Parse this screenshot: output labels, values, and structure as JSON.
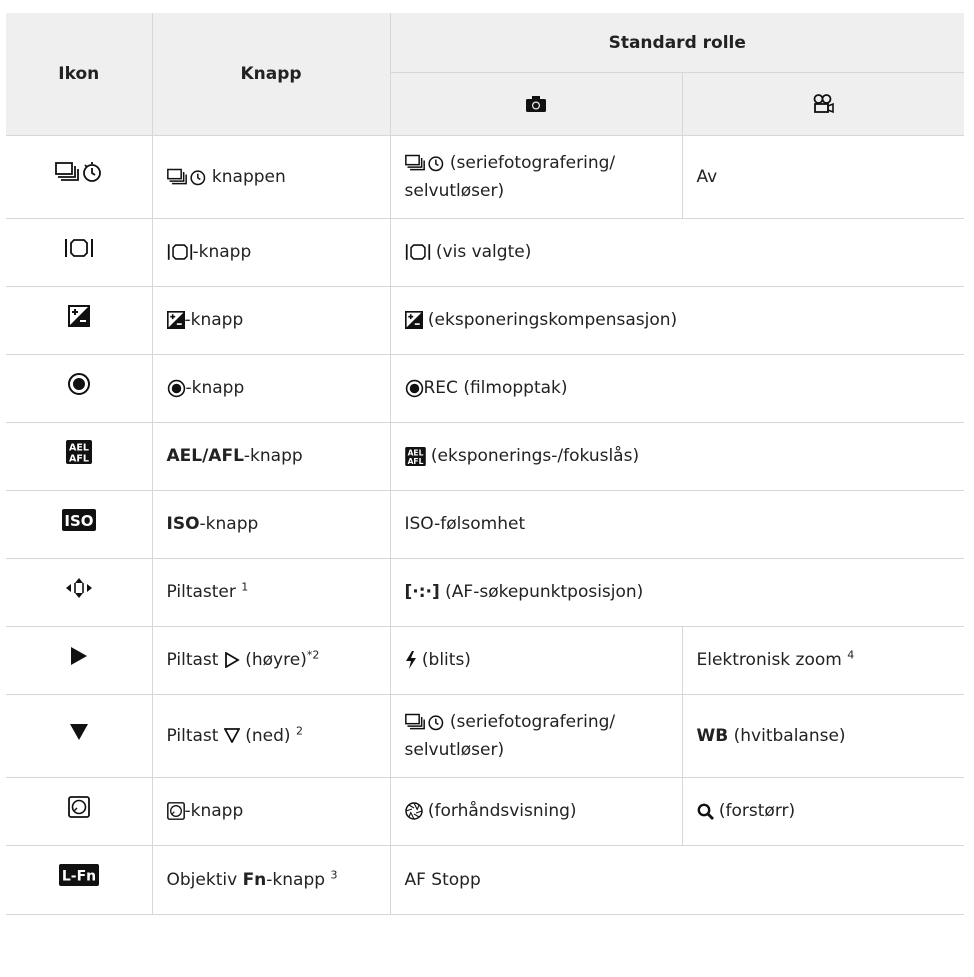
{
  "header": {
    "ikon": "Ikon",
    "knapp": "Knapp",
    "standard_rolle": "Standard rolle",
    "photo_icon": "camera-icon",
    "video_icon": "movie-icon"
  },
  "rows": [
    {
      "icon": "drive-selftimer-icon",
      "knapp": "knappen",
      "photo": "(seriefotografering/ selvutløser)",
      "video": "Av"
    },
    {
      "icon": "display-selected-icon",
      "knapp": "-knapp",
      "role": "(vis valgte)"
    },
    {
      "icon": "exposure-compensation-icon",
      "knapp": "-knapp",
      "role": "(eksponeringskompensasjon)"
    },
    {
      "icon": "record-icon",
      "knapp": "-knapp",
      "role_pre": "REC",
      "role": "(filmopptak)"
    },
    {
      "icon": "ael-afl-icon",
      "knapp_bold": "AEL/AFL",
      "knapp": "-knapp",
      "role": "(eksponerings-/fokuslås)"
    },
    {
      "icon": "iso-icon",
      "knapp_bold": "ISO",
      "knapp": "-knapp",
      "role": "ISO-følsomhet"
    },
    {
      "icon": "arrow-keys-icon",
      "knapp": "Piltaster",
      "knapp_sup": "1",
      "role_pre": "[·:·]",
      "role": "(AF-søkepunktposisjon)"
    },
    {
      "icon": "right-arrow-icon",
      "knapp": "Piltast",
      "knapp_tail": "(høyre)",
      "knapp_sup": "*2",
      "photo": "(blits)",
      "video": "Elektronisk zoom",
      "video_sup": "4"
    },
    {
      "icon": "down-arrow-icon",
      "knapp": "Piltast",
      "knapp_tail": "(ned)",
      "knapp_sup": "2",
      "photo": "(seriefotografering/ selvutløser)",
      "video_bold": "WB",
      "video": "(hvitbalanse)"
    },
    {
      "icon": "preview-icon",
      "knapp": "-knapp",
      "photo": "(forhåndsvisning)",
      "video": "(forstørr)"
    },
    {
      "icon": "lens-fn-icon",
      "knapp": "Objektiv",
      "knapp_bold": "Fn",
      "knapp_tail": "-knapp",
      "knapp_sup": "3",
      "role": "AF Stopp"
    }
  ]
}
